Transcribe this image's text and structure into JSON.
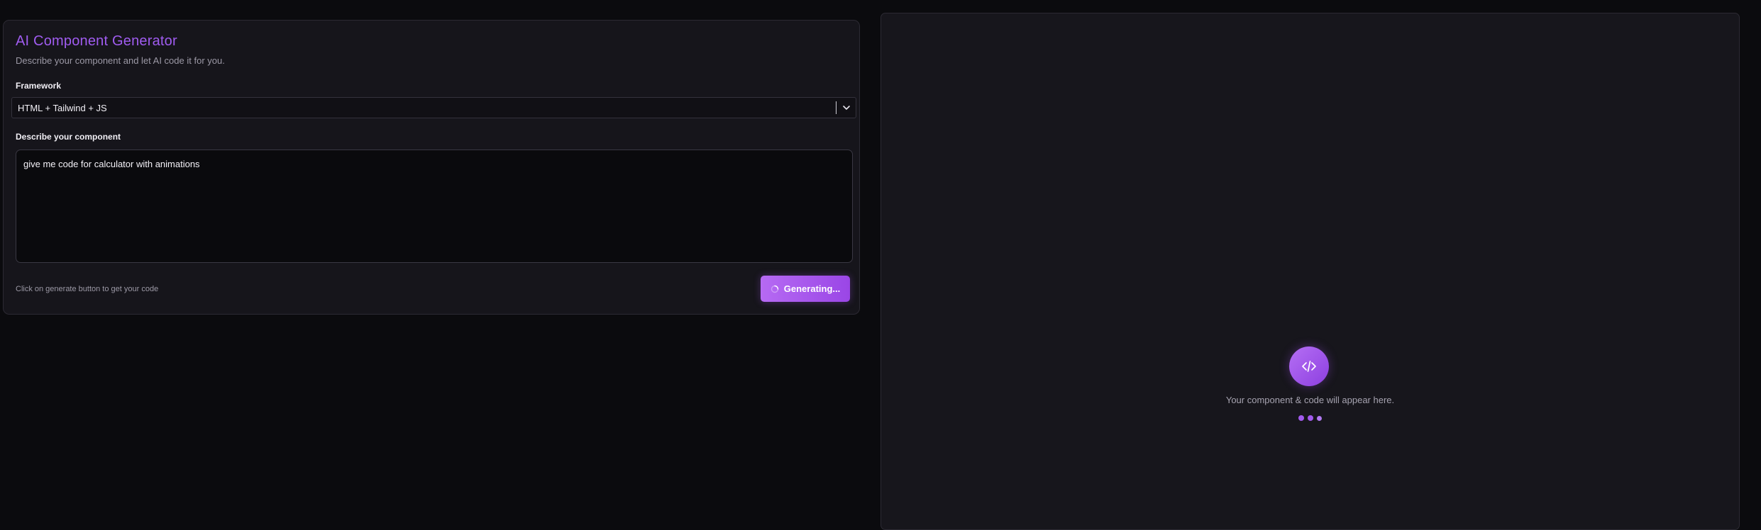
{
  "generator": {
    "title": "AI Component Generator",
    "subtitle": "Describe your component and let AI code it for you.",
    "framework_label": "Framework",
    "framework_value": "HTML + Tailwind + JS",
    "describe_label": "Describe your component",
    "prompt_value": "give me code for calculator with animations",
    "hint": "Click on generate button to get your code",
    "generate_button_label": "Generating...",
    "generate_button_state": "loading"
  },
  "preview": {
    "icon": "code-icon",
    "placeholder": "Your component & code will appear here.",
    "loading_indicator": "dots"
  },
  "colors": {
    "background": "#0b0b0e",
    "panel": "#16151b",
    "accent": "#a05cf0",
    "accent_light": "#b66af3"
  }
}
